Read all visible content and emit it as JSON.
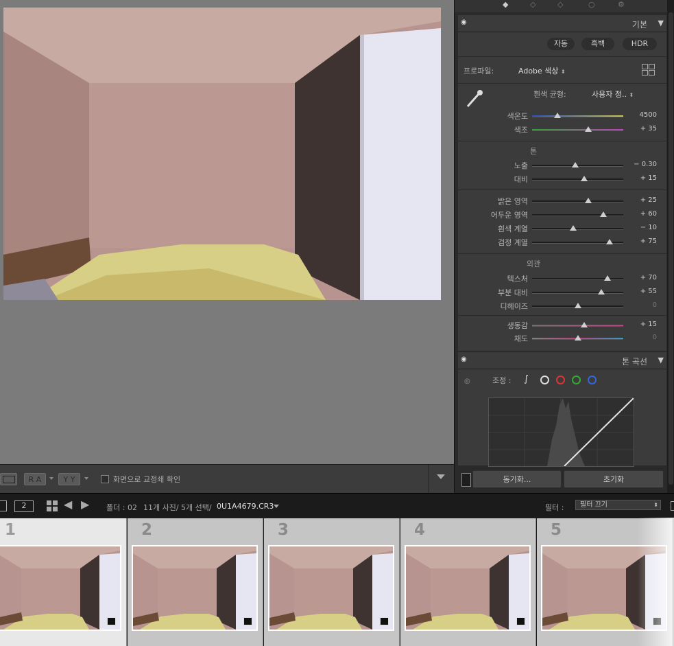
{
  "viewer": {
    "toolbar": {
      "ra_label": "R A",
      "yy_label": "Y Y",
      "proof_label": "화면으로 교정쇄 확인"
    }
  },
  "panel": {
    "basic": {
      "title": "기본",
      "treatment": [
        "자동",
        "흑백",
        "HDR"
      ],
      "profile_label": "프로파일:",
      "profile_value": "Adobe 색상",
      "wb_label": "흰색 균형:",
      "wb_value": "사용자 정..",
      "wb_rows": [
        {
          "label": "색온도",
          "value": "4500",
          "pos": 0.28
        },
        {
          "label": "색조",
          "value": "+ 35",
          "pos": 0.62
        }
      ],
      "tone_title": "톤",
      "tone_rows": [
        {
          "label": "노출",
          "value": "− 0.30",
          "pos": 0.47
        },
        {
          "label": "대비",
          "value": "+ 15",
          "pos": 0.57
        }
      ],
      "tone2_rows": [
        {
          "label": "밝은 영역",
          "value": "+ 25",
          "pos": 0.62
        },
        {
          "label": "어두운 영역",
          "value": "+ 60",
          "pos": 0.78
        },
        {
          "label": "흰색 계열",
          "value": "− 10",
          "pos": 0.45
        },
        {
          "label": "검정 계열",
          "value": "+ 75",
          "pos": 0.85
        }
      ],
      "presence_title": "외관",
      "presence_rows": [
        {
          "label": "텍스처",
          "value": "+ 70",
          "pos": 0.83
        },
        {
          "label": "부분 대비",
          "value": "+ 55",
          "pos": 0.76
        },
        {
          "label": "디헤이즈",
          "value": "0",
          "pos": 0.5,
          "dim": true
        }
      ],
      "color_rows": [
        {
          "label": "생동감",
          "value": "+ 15",
          "pos": 0.57
        },
        {
          "label": "채도",
          "value": "0",
          "pos": 0.5,
          "dim": true
        }
      ]
    },
    "tone_curve": {
      "title": "톤 곡선",
      "adjust_label": "조정 :"
    },
    "sync_label": "동기화...",
    "reset_label": "초기화"
  },
  "filmbar": {
    "screen2": "2",
    "folder": "폴더 : 02",
    "counts": "11개 사진/ 5개 선택/",
    "filename": "0U1A4679.CR3",
    "filter_label": "필터 :",
    "filter_value": "필터 끄기"
  },
  "filmstrip": [
    "1",
    "2",
    "3",
    "4",
    "5"
  ]
}
